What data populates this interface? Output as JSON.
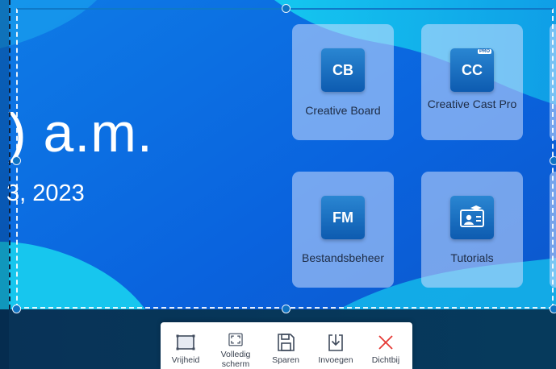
{
  "clock": {
    "time": ") a.m.",
    "date": "3, 2023"
  },
  "apps": [
    {
      "name": "Creative Board",
      "icon_text": "CB",
      "icon": "creative-board-icon"
    },
    {
      "name": "Creative Cast Pro",
      "icon_text": "CC",
      "icon": "creative-cast-icon",
      "badge": "PRO"
    },
    {
      "name": "Bestandsbeheer",
      "icon_text": "FM",
      "icon": "file-manager-icon"
    },
    {
      "name": "Tutorials",
      "icon_text": "",
      "icon": "tutorials-icon"
    }
  ],
  "toolbar": {
    "items": [
      {
        "label": "Vrijheid",
        "icon": "freeform-rect-icon"
      },
      {
        "label": "Volledig scherm",
        "icon": "fullscreen-icon"
      },
      {
        "label": "Sparen",
        "icon": "save-icon"
      },
      {
        "label": "Invoegen",
        "icon": "insert-icon"
      },
      {
        "label": "Dichtbij",
        "icon": "close-icon"
      }
    ]
  },
  "colors": {
    "accent": "#0f73c3",
    "close": "#e53935",
    "tile_bg": "#cddeff",
    "tile_text": "#1d2b44",
    "wallpaper_cyan": "#14c4ec",
    "wallpaper_blue": "#0b5fd9"
  }
}
